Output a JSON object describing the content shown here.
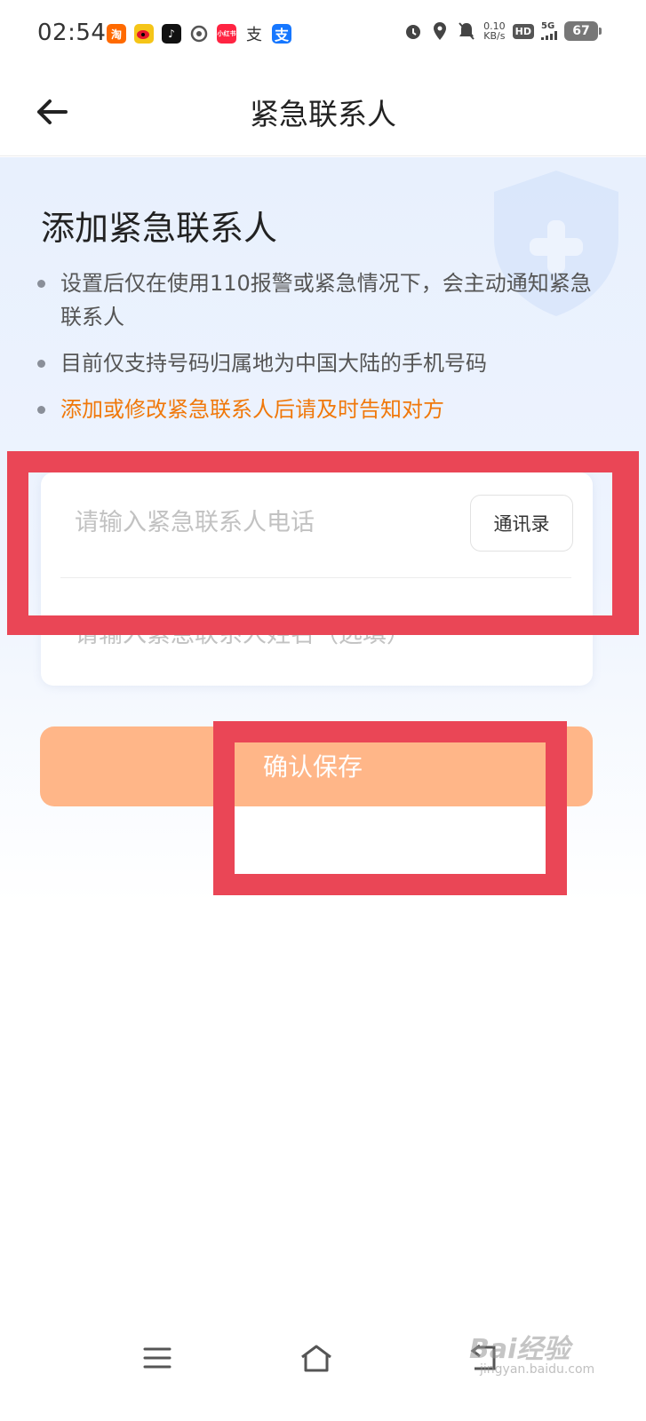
{
  "status_bar": {
    "time": "02:54",
    "app_icons": [
      "taobao-icon",
      "weibo-icon",
      "tiktok-icon",
      "browser-icon",
      "xiaohongshu-icon",
      "alipay-outline-icon",
      "alipay-icon"
    ],
    "net_speed_value": "0.10",
    "net_speed_unit": "KB/s",
    "hd_label": "HD",
    "network_label": "5G",
    "battery": "67"
  },
  "nav": {
    "title": "紧急联系人"
  },
  "intro": {
    "title": "添加紧急联系人",
    "bullets": [
      "设置后仅在使用110报警或紧急情况下，会主动通知紧急联系人",
      "目前仅支持号码归属地为中国大陆的手机号码"
    ],
    "warning": "添加或修改紧急联系人后请及时告知对方"
  },
  "form": {
    "phone_placeholder": "请输入紧急联系人电话",
    "contacts_button": "通讯录",
    "name_placeholder": "请输入紧急联系人姓名（选填）"
  },
  "save_button": {
    "label": "确认保存"
  },
  "colors": {
    "accent_orange": "#f0780a",
    "button_bg": "#ffb688",
    "annotation_red": "#ea4656"
  },
  "watermark": {
    "text": "Bai经验",
    "sub": "jingyan.baidu.com"
  }
}
